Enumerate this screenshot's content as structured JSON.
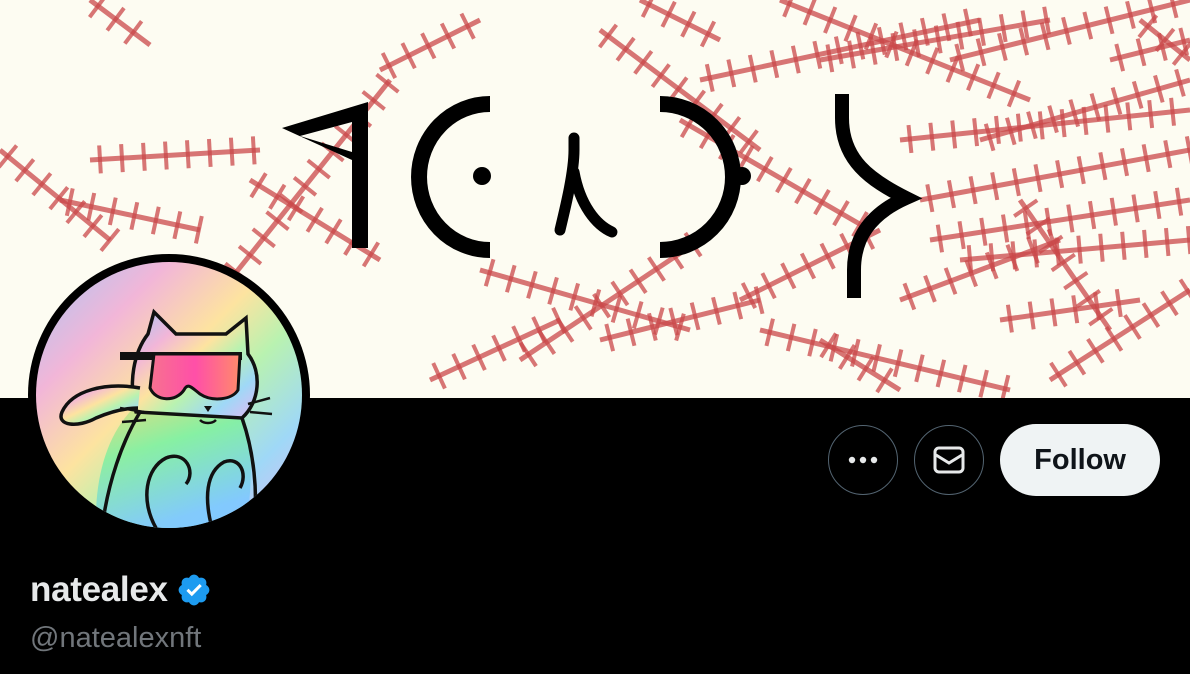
{
  "profile": {
    "display_name": "natealex",
    "handle": "@natealexnft",
    "verified": true,
    "verified_icon": "verified-badge-icon"
  },
  "banner": {
    "glyph_text": "ᑫᑕᒍᑐᕋ",
    "pattern_color": "#c9484a",
    "background_color": "#fdfcf2"
  },
  "actions": {
    "more_icon": "more-icon",
    "message_icon": "mail-icon",
    "follow_label": "Follow"
  },
  "colors": {
    "page_bg": "#000000",
    "name_color": "#e7e9ea",
    "handle_color": "#71767b",
    "verified_color": "#1d9bf0",
    "follow_bg": "#eff3f4"
  }
}
